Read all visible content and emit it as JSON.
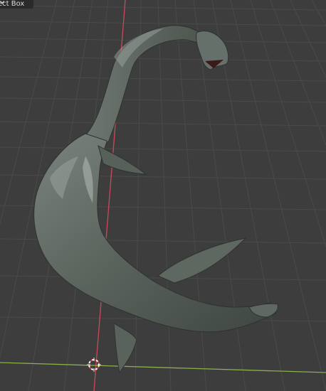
{
  "viewport": {
    "select_mode_label": "ect Box",
    "select_mode_chevron": "chevron-down-icon",
    "colors": {
      "background": "#3d3d3d",
      "grid": "#4a4a4a",
      "y_axis": "#c84a5a",
      "x_axis": "#8ab04a",
      "model": "#5f6761"
    },
    "object_name": "plesiosaur-model",
    "cursor_icon": "3d-cursor-icon"
  }
}
